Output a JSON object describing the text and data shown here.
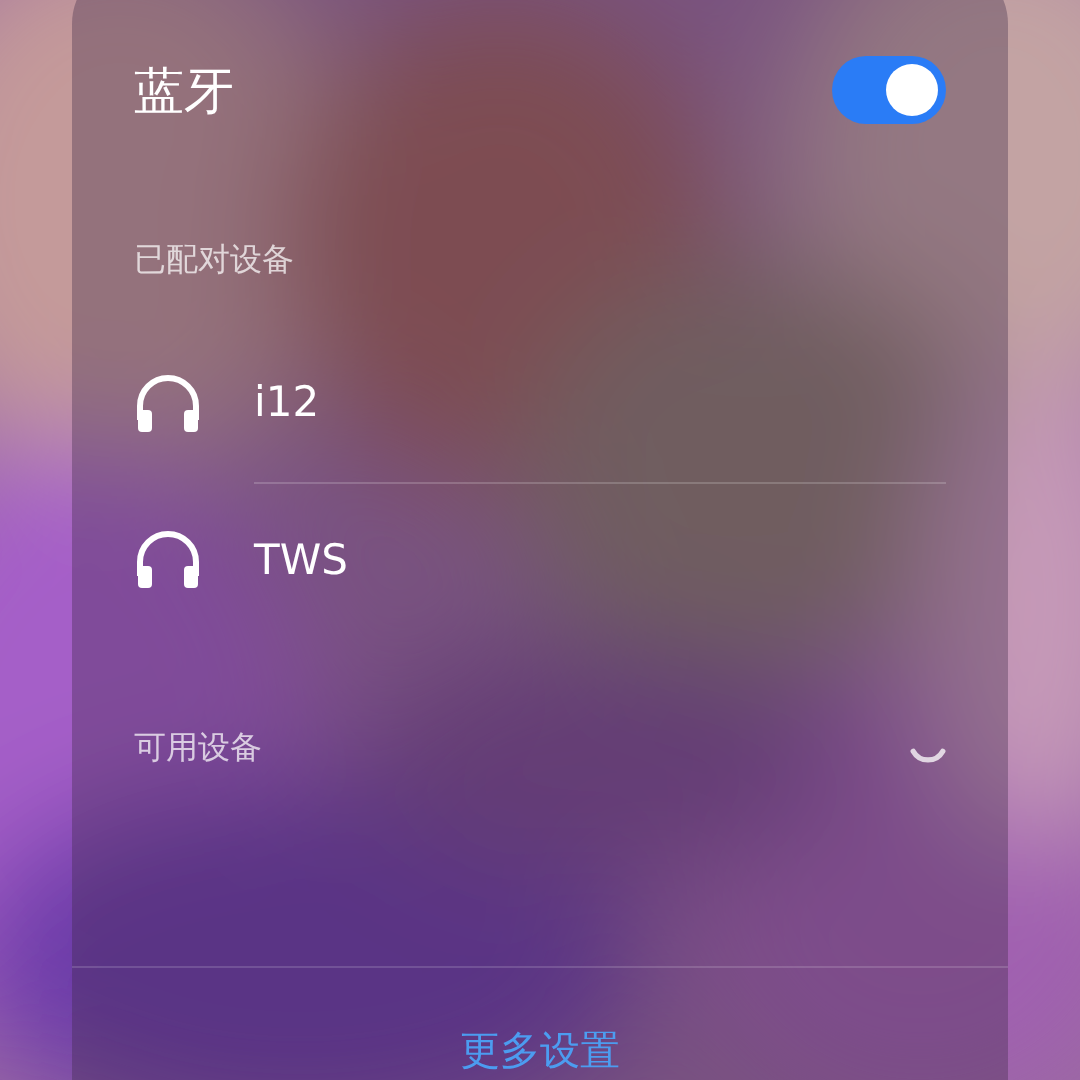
{
  "title": "蓝牙",
  "bluetooth_on": true,
  "paired_heading": "已配对设备",
  "paired_devices": [
    {
      "name": "i12"
    },
    {
      "name": "TWS"
    }
  ],
  "available_heading": "可用设备",
  "scanning": true,
  "more_settings": "更多设置"
}
